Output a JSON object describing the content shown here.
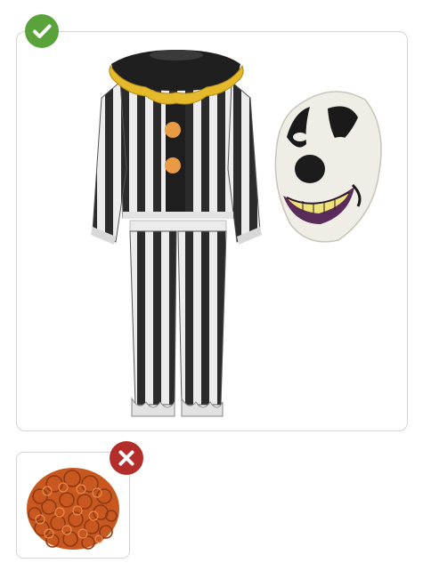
{
  "included_panel": {
    "status_icon": "checkmark-icon",
    "status_color": "#5aa33a",
    "items": [
      "striped-clown-costume",
      "clown-mask"
    ]
  },
  "excluded_panel": {
    "status_icon": "cross-icon",
    "status_color": "#b32d2b",
    "items": [
      "orange-curly-wig"
    ]
  },
  "colors": {
    "stripe_dark": "#2a2a2a",
    "stripe_light": "#e9e9e9",
    "collar_gold": "#e6b92a",
    "pompom_orange": "#e89a45",
    "wig_orange": "#c8581f"
  }
}
